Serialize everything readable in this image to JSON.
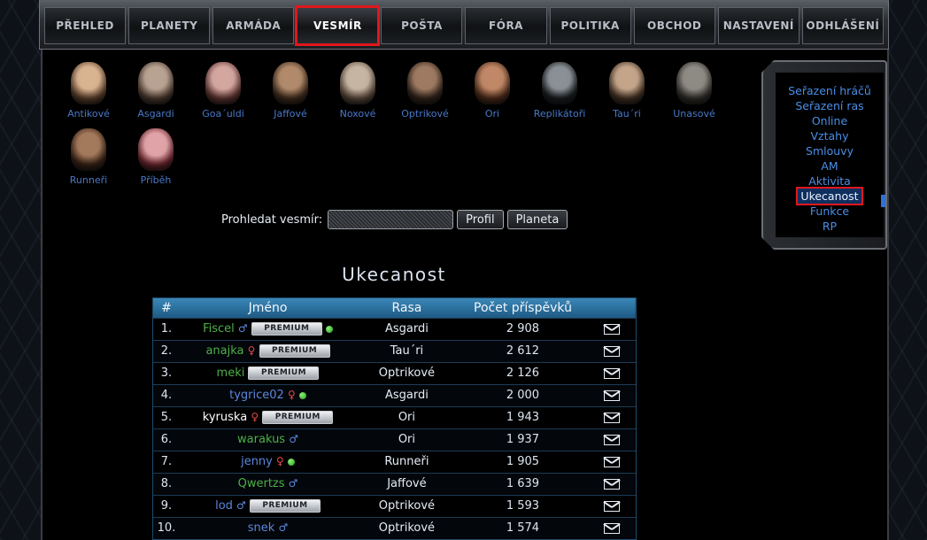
{
  "nav": {
    "items": [
      {
        "label": "PŘEHLED"
      },
      {
        "label": "PLANETY"
      },
      {
        "label": "ARMÁDA"
      },
      {
        "label": "VESMÍR",
        "active": true
      },
      {
        "label": "POŠTA"
      },
      {
        "label": "FÓRA"
      },
      {
        "label": "POLITIKA"
      },
      {
        "label": "OBCHOD"
      },
      {
        "label": "NASTAVENÍ"
      },
      {
        "label": "ODHLÁŠENÍ"
      }
    ]
  },
  "races": [
    {
      "label": "Antikové",
      "c1": "#d9b491",
      "c2": "#6b4a33"
    },
    {
      "label": "Asgardi",
      "c1": "#b8a292",
      "c2": "#5a4538"
    },
    {
      "label": "Goa´uldi",
      "c1": "#d4a6a0",
      "c2": "#6e3f3a"
    },
    {
      "label": "Jaffové",
      "c1": "#b08a6a",
      "c2": "#4b3322"
    },
    {
      "label": "Noxové",
      "c1": "#c6b5a3",
      "c2": "#6a5646"
    },
    {
      "label": "Optrikové",
      "c1": "#9e7a62",
      "c2": "#3a2a20"
    },
    {
      "label": "Ori",
      "c1": "#c08866",
      "c2": "#5a3320"
    },
    {
      "label": "Replikátoři",
      "c1": "#8a9096",
      "c2": "#1e2226"
    },
    {
      "label": "Tau´ri",
      "c1": "#c4a58a",
      "c2": "#4e3a2a"
    },
    {
      "label": "Unasové",
      "c1": "#8e8a84",
      "c2": "#3a3632"
    },
    {
      "label": "Runneři",
      "c1": "#a47a5c",
      "c2": "#40281a"
    },
    {
      "label": "Příběh",
      "c1": "#e0a4a8",
      "c2": "#7a2c34"
    }
  ],
  "search": {
    "label": "Prohledat vesmír:",
    "profile_button": "Profil",
    "planet_button": "Planeta"
  },
  "page": {
    "title": "Ukecanost"
  },
  "table": {
    "headers": {
      "rank": "#",
      "name": "Jméno",
      "race": "Rasa",
      "posts": "Počet příspěvků"
    },
    "premium_label": "PREMIUM",
    "rows": [
      {
        "rank": "1.",
        "name": "Fiscel",
        "sex": "♂",
        "premium": true,
        "online": true,
        "race": "Asgardi",
        "posts": "2 908",
        "color": "green"
      },
      {
        "rank": "2.",
        "name": "anajka",
        "sex": "♀",
        "premium": true,
        "online": false,
        "race": "Tau´ri",
        "posts": "2 612",
        "color": "green"
      },
      {
        "rank": "3.",
        "name": "meki",
        "sex": "",
        "premium": true,
        "online": false,
        "race": "Optrikové",
        "posts": "2 126",
        "color": "green"
      },
      {
        "rank": "4.",
        "name": "tygrice02",
        "sex": "♀",
        "premium": false,
        "online": true,
        "race": "Asgardi",
        "posts": "2 000",
        "color": "blue"
      },
      {
        "rank": "5.",
        "name": "kyruska",
        "sex": "♀",
        "premium": true,
        "online": false,
        "race": "Ori",
        "posts": "1 943",
        "color": "white"
      },
      {
        "rank": "6.",
        "name": "warakus",
        "sex": "♂",
        "premium": false,
        "online": false,
        "race": "Ori",
        "posts": "1 937",
        "color": "green"
      },
      {
        "rank": "7.",
        "name": "jenny",
        "sex": "♀",
        "premium": false,
        "online": true,
        "race": "Runneři",
        "posts": "1 905",
        "color": "blue"
      },
      {
        "rank": "8.",
        "name": "Qwertzs",
        "sex": "♂",
        "premium": false,
        "online": false,
        "race": "Jaffové",
        "posts": "1 639",
        "color": "green"
      },
      {
        "rank": "9.",
        "name": "lod",
        "sex": "♂",
        "premium": true,
        "online": false,
        "race": "Optrikové",
        "posts": "1 593",
        "color": "blue"
      },
      {
        "rank": "10.",
        "name": "snek",
        "sex": "♂",
        "premium": false,
        "online": false,
        "race": "Optrikové",
        "posts": "1 574",
        "color": "blue"
      }
    ]
  },
  "side_menu": {
    "items": [
      {
        "label": "Seřazení hráčů"
      },
      {
        "label": "Seřazení ras"
      },
      {
        "label": "Online"
      },
      {
        "label": "Vztahy"
      },
      {
        "label": "Smlouvy"
      },
      {
        "label": "AM"
      },
      {
        "label": "Aktivita"
      },
      {
        "label": "Ukecanost",
        "active": true
      },
      {
        "label": "Funkce"
      },
      {
        "label": "RP"
      }
    ]
  }
}
